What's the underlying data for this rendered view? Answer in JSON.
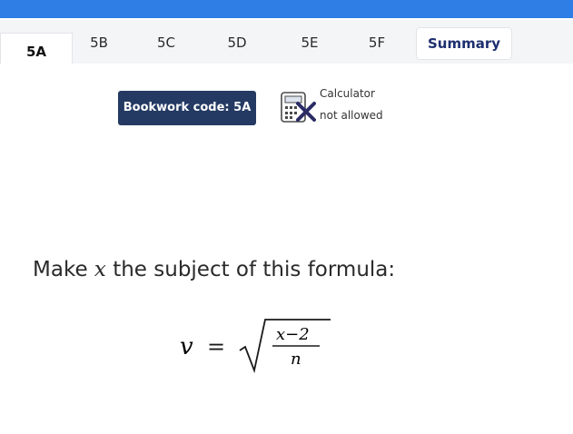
{
  "tabs": [
    {
      "label": "5A",
      "active": true
    },
    {
      "label": "5B"
    },
    {
      "label": "5C"
    },
    {
      "label": "5D"
    },
    {
      "label": "5E"
    },
    {
      "label": "5F"
    },
    {
      "label": "Summary"
    }
  ],
  "bookwork": {
    "label": "Bookwork code: 5A"
  },
  "calculator": {
    "title": "Calculator",
    "status": "not allowed",
    "icon": "calculator-crossed-icon"
  },
  "question": {
    "prefix": "Make ",
    "variable": "x",
    "suffix": " the subject of this formula:"
  },
  "formula": {
    "lhs": "v",
    "equals": "=",
    "numerator": "x−2",
    "denominator": "n"
  },
  "colors": {
    "accent": "#2f7ee6",
    "bookwork_bg": "#243a63",
    "cross": "#2b2b66"
  }
}
